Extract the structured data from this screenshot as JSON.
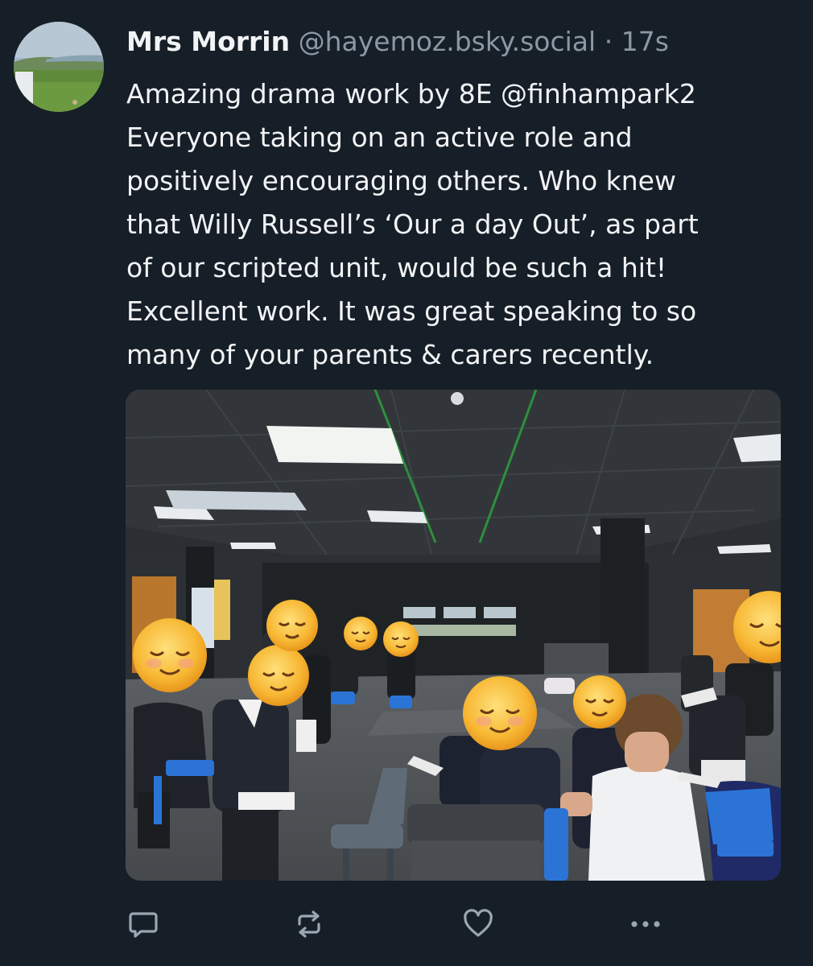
{
  "post": {
    "author": {
      "display_name": "Mrs Morrin",
      "handle": "@hayemoz.bsky.social",
      "separator": "·",
      "timestamp": "17s"
    },
    "text_lines": [
      "Amazing drama work by 8E ",
      "Everyone taking on an active role and",
      "positively encouraging others. Who knew",
      "that Willy Russell’s ‘Our a day Out’, as part",
      "of our scripted unit, would be such a hit!",
      "Excellent work. It was great speaking to so",
      "many of your parents & carers recently."
    ],
    "mention": "@finhampark2",
    "media": {
      "kind": "photo"
    }
  },
  "actions": [
    {
      "name": "reply",
      "icon": "speech-bubble-icon"
    },
    {
      "name": "repost",
      "icon": "repost-arrows-icon"
    },
    {
      "name": "like",
      "icon": "heart-icon"
    },
    {
      "name": "more",
      "icon": "ellipsis-icon"
    }
  ],
  "colors": {
    "background": "#161e27",
    "text_primary": "#f1f3f5",
    "text_secondary": "#8b98a5",
    "icon": "#9aa6b2"
  }
}
